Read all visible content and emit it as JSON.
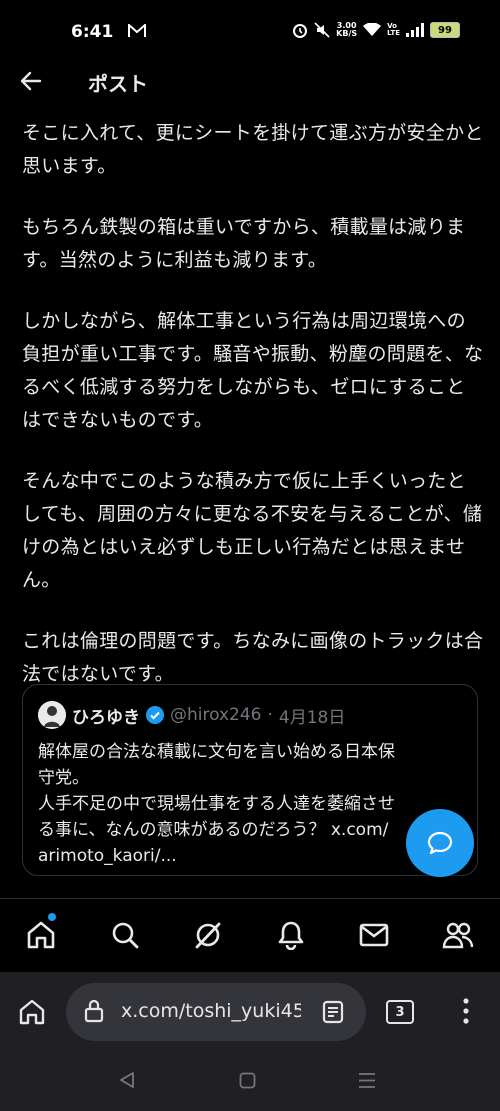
{
  "status_bar": {
    "time": "6:41",
    "speed_value": "3.00",
    "speed_unit": "KB/S",
    "volte_top": "Vo",
    "volte_bottom": "LTE",
    "battery": "99"
  },
  "header": {
    "title": "ポスト"
  },
  "post": {
    "paragraphs": [
      "そこに入れて、更にシートを掛けて運ぶ方が安全かと思います。",
      "もちろん鉄製の箱は重いですから、積載量は減ります。当然のように利益も減ります。",
      "しかしながら、解体工事という行為は周辺環境への負担が重い工事です。騒音や振動、粉塵の問題を、なるべく低減する努力をしながらも、ゼロにすることはできないものです。",
      "そんな中でこのような積み方で仮に上手くいったとしても、周囲の方々に更なる不安を与えることが、儲けの為とはいえ必ずしも正しい行為だとは思えません。",
      "これは倫理の問題です。ちなみに画像のトラックは合法ではないです。"
    ]
  },
  "quote": {
    "name": "ひろゆき",
    "handle": "@hirox246",
    "separator": "·",
    "date": "4月18日",
    "lines": [
      "解体屋の合法な積載に文句を言い始める日本保",
      "守党。",
      "人手不足の中で現場仕事をする人達を萎縮させ",
      "る事に、なんの意味があるのだろう？ x.com/",
      "arimoto_kaori/..."
    ]
  },
  "browser": {
    "url": "x.com/toshi_yuki45",
    "tab_count": "3"
  },
  "colors": {
    "accent": "#1d9bf0",
    "background": "#000000",
    "text": "#e7e9ea",
    "muted": "#71767b"
  }
}
